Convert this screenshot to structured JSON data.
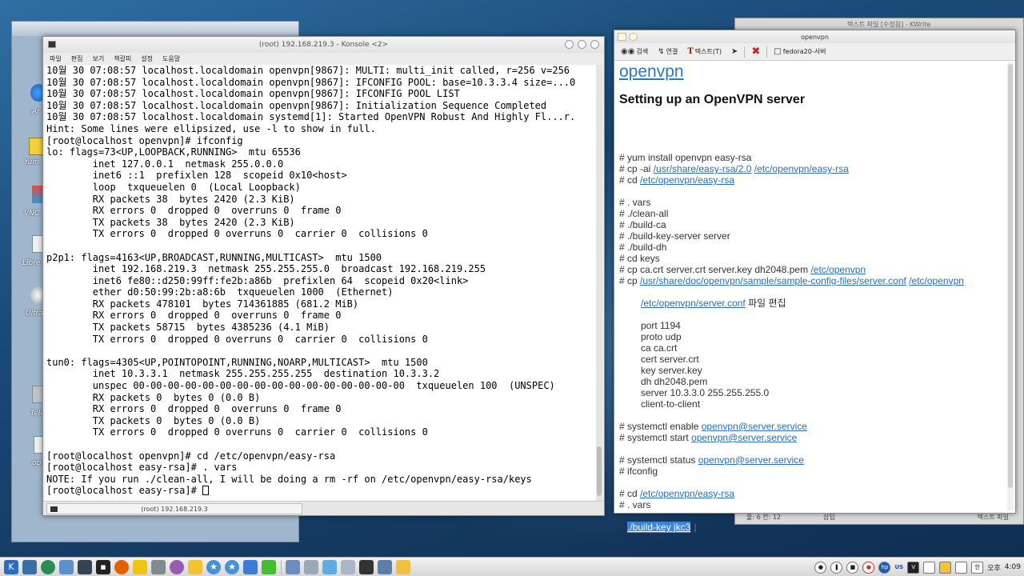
{
  "desktop": {
    "labels": [
      "Ar",
      "Yum",
      "VNC",
      "Libre",
      "Ultra",
      "Tele",
      "op"
    ]
  },
  "konsole": {
    "title": "(root) 192.168.219.3 - Konsole <2>",
    "menu": [
      "파일",
      "편집",
      "보기",
      "책갈피",
      "설정",
      "도움말"
    ],
    "lines": [
      "10월 30 07:08:57 localhost.localdomain openvpn[9867]: MULTI: multi_init called, r=256 v=256",
      "10월 30 07:08:57 localhost.localdomain openvpn[9867]: IFCONFIG POOL: base=10.3.3.4 size=...0",
      "10월 30 07:08:57 localhost.localdomain openvpn[9867]: IFCONFIG POOL LIST",
      "10월 30 07:08:57 localhost.localdomain openvpn[9867]: Initialization Sequence Completed",
      "10월 30 07:08:57 localhost.localdomain systemd[1]: Started OpenVPN Robust And Highly Fl...r.",
      "Hint: Some lines were ellipsized, use -l to show in full.",
      "[root@localhost openvpn]# ifconfig",
      "lo: flags=73<UP,LOOPBACK,RUNNING>  mtu 65536",
      "        inet 127.0.0.1  netmask 255.0.0.0",
      "        inet6 ::1  prefixlen 128  scopeid 0x10<host>",
      "        loop  txqueuelen 0  (Local Loopback)",
      "        RX packets 38  bytes 2420 (2.3 KiB)",
      "        RX errors 0  dropped 0  overruns 0  frame 0",
      "        TX packets 38  bytes 2420 (2.3 KiB)",
      "        TX errors 0  dropped 0 overruns 0  carrier 0  collisions 0",
      "",
      "p2p1: flags=4163<UP,BROADCAST,RUNNING,MULTICAST>  mtu 1500",
      "        inet 192.168.219.3  netmask 255.255.255.0  broadcast 192.168.219.255",
      "        inet6 fe80::d250:99ff:fe2b:a86b  prefixlen 64  scopeid 0x20<link>",
      "        ether d0:50:99:2b:a8:6b  txqueuelen 1000  (Ethernet)",
      "        RX packets 478101  bytes 714361885 (681.2 MiB)",
      "        RX errors 0  dropped 0  overruns 0  frame 0",
      "        TX packets 58715  bytes 4385236 (4.1 MiB)",
      "        TX errors 0  dropped 0 overruns 0  carrier 0  collisions 0",
      "",
      "tun0: flags=4305<UP,POINTOPOINT,RUNNING,NOARP,MULTICAST>  mtu 1500",
      "        inet 10.3.3.1  netmask 255.255.255.255  destination 10.3.3.2",
      "        unspec 00-00-00-00-00-00-00-00-00-00-00-00-00-00-00-00  txqueuelen 100  (UNSPEC)",
      "        RX packets 0  bytes 0 (0.0 B)",
      "        RX errors 0  dropped 0  overruns 0  frame 0",
      "        TX packets 0  bytes 0 (0.0 B)",
      "        TX errors 0  dropped 0 overruns 0  carrier 0  collisions 0",
      "",
      "[root@localhost openvpn]# cd /etc/openvpn/easy-rsa",
      "[root@localhost easy-rsa]# . vars",
      "NOTE: If you run ./clean-all, I will be doing a rm -rf on /etc/openvpn/easy-rsa/keys"
    ],
    "prompt": "[root@localhost easy-rsa]# ",
    "tab_label": "(root) 192.168.219.3"
  },
  "kwrite": {
    "title": "텍스트 파일 [수정됨] - KWrite",
    "status_left": "줄: 6 칸: 12",
    "status_mid": "삽입",
    "status_right": "텍스트 파일"
  },
  "browser": {
    "title": "openvpn",
    "toolbar": {
      "search": "검색",
      "link": "연결",
      "text": "텍스트(T)",
      "server": "fedora20-서버"
    },
    "logo": "openvpn",
    "heading": "Setting up an OpenVPN server",
    "l1": "# yum install openvpn easy-rsa",
    "l2a": "# cp -ai ",
    "l2b": "/usr/share/easy-rsa/2.0",
    "l2c": "/etc/openvpn/easy-rsa",
    "l3a": "# cd ",
    "l3b": "/etc/openvpn/easy-rsa",
    "l4": "# . vars",
    "l5": "# ./clean-all",
    "l6": "# ./build-ca",
    "l7": "# ./build-key-server server",
    "l8": "# ./build-dh",
    "l9": "# cd keys",
    "l10a": "# cp ca.crt server.crt server.key dh2048.pem ",
    "l10b": "/etc/openvpn",
    "l11a": "# cp ",
    "l11b": "/usr/share/doc/openvpn/sample/sample-config-files/server.conf",
    "l11c": "/etc/openvpn",
    "l12a": "/etc/openvpn/server.conf",
    "l12b": " 파일 편집",
    "conf": [
      "port 1194",
      "proto udp",
      "ca ca.crt",
      "cert server.crt",
      "key server.key",
      "dh dh2048.pem",
      "server 10.3.3.0 255.255.255.0",
      "client-to-client"
    ],
    "l13a": "# systemctl enable ",
    "l13b": "openvpn@server.service",
    "l14a": "# systemctl start ",
    "l14b": "openvpn@server.service",
    "l15a": "# systemctl status ",
    "l15b": "openvpn@server.service",
    "l16": "# ifconfig",
    "l17a": "# cd ",
    "l17b": "/etc/openvpn/easy-rsa",
    "l18": "# . vars",
    "l19a": "# ",
    "l19b": "./build-key jkc3"
  },
  "taskbar": {
    "lang": "US",
    "ampm": "오후",
    "time": "4:09"
  },
  "colors": {
    "link": "#2a6ebb",
    "highlight": "#3c84d8",
    "logo": "#2a7ac7"
  }
}
